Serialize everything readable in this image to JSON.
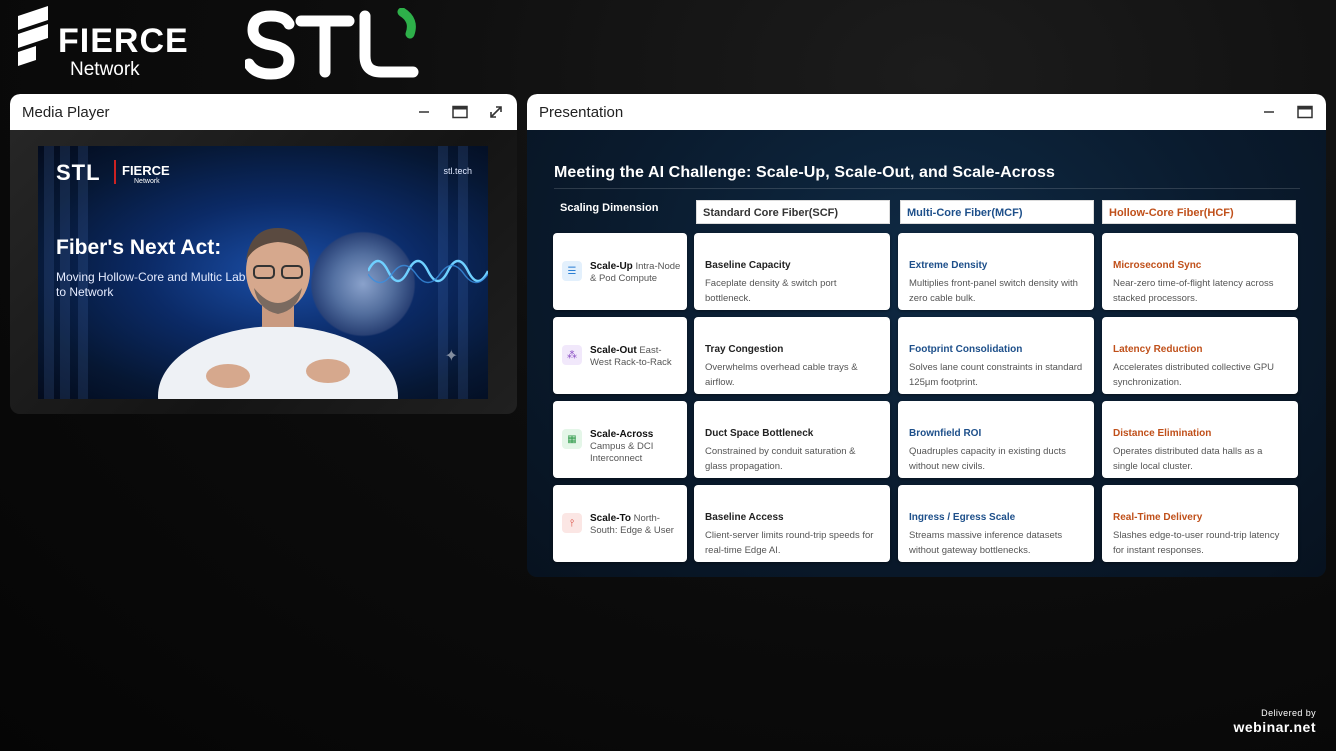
{
  "header": {
    "fierce_logo": {
      "line1": "FIERCE",
      "line2": "Network"
    },
    "stl_logo": {
      "text": "STL"
    }
  },
  "media_player": {
    "title": "Media Player",
    "video": {
      "brand_stl": "STL",
      "brand_fierce": "FIERCE",
      "brand_network": "Network",
      "site": "stl.tech",
      "headline": "Fiber's Next Act:",
      "subline": "Moving Hollow-Core and Multic Lab to Network"
    }
  },
  "presentation": {
    "title": "Presentation",
    "slide": {
      "title": "Meeting the AI Challenge: Scale-Up, Scale-Out, and Scale-Across",
      "dimension_header": "Scaling Dimension",
      "columns": [
        "Standard Core Fiber(SCF)",
        "Multi-Core Fiber(MCF)",
        "Hollow-Core Fiber(HCF)"
      ],
      "rows": [
        {
          "dim_title": "Scale-Up",
          "dim_desc": "Intra-Node & Pod Compute",
          "icon": "server-icon",
          "icon_color": "#2a7fd4",
          "icon_bg": "#e3f0fc",
          "scf": {
            "head": "Baseline Capacity",
            "desc": "Faceplate density & switch port bottleneck."
          },
          "mcf": {
            "head": "Extreme Density",
            "desc": "Multiplies front-panel switch density with zero cable bulk."
          },
          "hcf": {
            "head": "Microsecond Sync",
            "desc": "Near-zero time-of-flight latency across stacked processors."
          }
        },
        {
          "dim_title": "Scale-Out",
          "dim_desc": "East-West Rack-to-Rack",
          "icon": "network-icon",
          "icon_color": "#8a4fc4",
          "icon_bg": "#f1e8fb",
          "scf": {
            "head": "Tray Congestion",
            "desc": "Overwhelms overhead cable trays & airflow."
          },
          "mcf": {
            "head": "Footprint Consolidation",
            "desc": "Solves lane count constraints in standard 125μm footprint."
          },
          "hcf": {
            "head": "Latency Reduction",
            "desc": "Accelerates distributed collective GPU synchronization."
          }
        },
        {
          "dim_title": "Scale-Across",
          "dim_desc": "Campus & DCI Interconnect",
          "icon": "building-icon",
          "icon_color": "#2f9a4a",
          "icon_bg": "#e4f6e8",
          "scf": {
            "head": "Duct Space Bottleneck",
            "desc": "Constrained by conduit saturation & glass propagation."
          },
          "mcf": {
            "head": "Brownfield ROI",
            "desc": "Quadruples capacity in existing ducts without new civils."
          },
          "hcf": {
            "head": "Distance Elimination",
            "desc": "Operates distributed data halls as a single local cluster."
          }
        },
        {
          "dim_title": "Scale-To",
          "dim_desc": "North-South: Edge & User",
          "icon": "antenna-icon",
          "icon_color": "#d9473a",
          "icon_bg": "#fbe6e4",
          "scf": {
            "head": "Baseline Access",
            "desc": "Client-server limits round-trip speeds for real-time Edge AI."
          },
          "mcf": {
            "head": "Ingress / Egress Scale",
            "desc": "Streams massive inference datasets without gateway bottlenecks."
          },
          "hcf": {
            "head": "Real-Time Delivery",
            "desc": "Slashes edge-to-user round-trip latency for instant responses."
          }
        }
      ]
    }
  },
  "footer": {
    "delivered_by": "Delivered by",
    "brand": "webinar.net"
  }
}
